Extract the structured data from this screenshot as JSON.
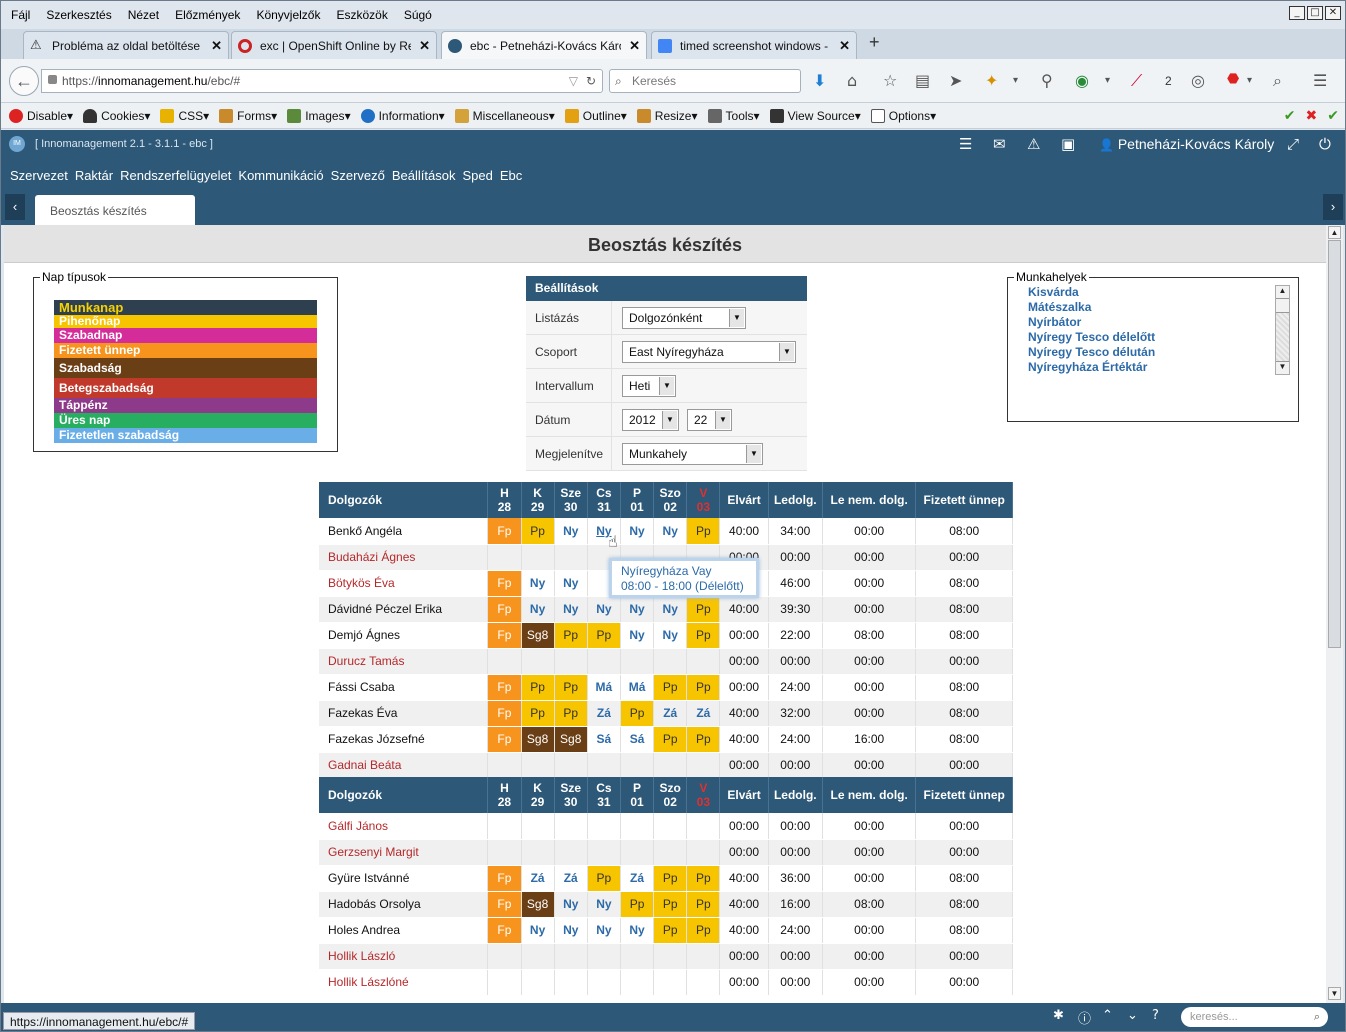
{
  "browser": {
    "menu": [
      "Fájl",
      "Szerkesztés",
      "Nézet",
      "Előzmények",
      "Könyvjelzők",
      "Eszközök",
      "Súgó"
    ],
    "tabs": [
      {
        "title": "Probléma az oldal betöltése k...",
        "icon": "warning-icon"
      },
      {
        "title": "exc | OpenShift Online by Re...",
        "icon": "openshift-icon"
      },
      {
        "title": "ebc - Petneházi-Kovács Károl...",
        "icon": "app-icon"
      },
      {
        "title": "timed screenshot windows - G...",
        "icon": "google-icon"
      }
    ],
    "url_prefix": "https://",
    "url_host": "innomanagement.hu",
    "url_path": "/ebc/#",
    "search_placeholder": "Keresés",
    "badge_count": "2",
    "devbar": [
      "Disable",
      "Cookies",
      "CSS",
      "Forms",
      "Images",
      "Information",
      "Miscellaneous",
      "Outline",
      "Resize",
      "Tools",
      "View Source",
      "Options"
    ]
  },
  "app": {
    "title": "[ Innomanagement 2.1 - 3.1.1 - ebc ]",
    "logo": "IM",
    "user": "Petneházi-Kovács Károly",
    "nav": [
      "Szervezet",
      "Raktár",
      "Rendszerfelügyelet",
      "Kommunikáció",
      "Szervező",
      "Beállítások",
      "Sped",
      "Ebc"
    ],
    "open_tab": "Beosztás készítés",
    "page_title": "Beosztás készítés"
  },
  "daytypes": {
    "legend": "Nap típusok",
    "items": [
      {
        "label": "Munkanap",
        "color": "#2e3f4f",
        "text": "#f7d200"
      },
      {
        "label": "Pihenőnap",
        "color": "#f7c400",
        "text": "#fff"
      },
      {
        "label": "Szabadnap",
        "color": "#d42d9a",
        "text": "#fff"
      },
      {
        "label": "Fizetett ünnep",
        "color": "#f7941d",
        "text": "#fff"
      },
      {
        "label": "Szabadság",
        "color": "#6b3f16",
        "text": "#fff"
      },
      {
        "label": "Betegszabadság",
        "color": "#c0392b",
        "text": "#fff"
      },
      {
        "label": "Táppénz",
        "color": "#8e3a8a",
        "text": "#fff"
      },
      {
        "label": "Üres nap",
        "color": "#27ae60",
        "text": "#fff"
      },
      {
        "label": "Fizetetlen szabadság",
        "color": "#6aaee8",
        "text": "#fff"
      }
    ]
  },
  "settings": {
    "header": "Beállítások",
    "rows": [
      {
        "label": "Listázás",
        "value": "Dolgozónként"
      },
      {
        "label": "Csoport",
        "value": "East Nyíregyháza"
      },
      {
        "label": "Intervallum",
        "value": "Heti"
      },
      {
        "label": "Dátum",
        "value": "2012",
        "value2": "22"
      },
      {
        "label": "Megjelenítve",
        "value": "Munkahely"
      }
    ]
  },
  "workplaces": {
    "legend": "Munkahelyek",
    "items": [
      "Kisvárda",
      "Mátészalka",
      "Nyírbátor",
      "Nyíregy Tesco délelőtt",
      "Nyíregy Tesco délután",
      "Nyíregyháza Értéktár"
    ]
  },
  "table": {
    "headers": {
      "name": "Dolgozók",
      "days": [
        [
          "H",
          "28"
        ],
        [
          "K",
          "29"
        ],
        [
          "Sze",
          "30"
        ],
        [
          "Cs",
          "31"
        ],
        [
          "P",
          "01"
        ],
        [
          "Szo",
          "02"
        ],
        [
          "V",
          "03"
        ]
      ],
      "cols": [
        "Elvárt",
        "Ledolg.",
        "Le nem. dolg.",
        "Fizetett ünnep"
      ]
    },
    "group1": [
      {
        "name": "Benkő Angéla",
        "red": false,
        "days": [
          "Fp",
          "Pp",
          "Ny",
          "Ny",
          "Ny",
          "Ny",
          "Pp"
        ],
        "vals": [
          "40:00",
          "34:00",
          "00:00",
          "08:00"
        ]
      },
      {
        "name": "Budaházi Ágnes",
        "red": true,
        "days": [
          "",
          "",
          "",
          "",
          "",
          "",
          ""
        ],
        "vals": [
          "00:00",
          "00:00",
          "00:00",
          "00:00"
        ]
      },
      {
        "name": "Bötykös Éva",
        "red": true,
        "days": [
          "Fp",
          "Ny",
          "Ny",
          "",
          "",
          "",
          ""
        ],
        "vals": [
          "",
          "46:00",
          "00:00",
          "08:00"
        ]
      },
      {
        "name": "Dávidné Péczel Erika",
        "red": false,
        "days": [
          "Fp",
          "Ny",
          "Ny",
          "Ny",
          "Ny",
          "Ny",
          "Pp"
        ],
        "vals": [
          "40:00",
          "39:30",
          "00:00",
          "08:00"
        ]
      },
      {
        "name": "Demjó Ágnes",
        "red": false,
        "days": [
          "Fp",
          "Sg8",
          "Pp",
          "Pp",
          "Ny",
          "Ny",
          "Pp"
        ],
        "vals": [
          "00:00",
          "22:00",
          "08:00",
          "08:00"
        ]
      },
      {
        "name": "Durucz Tamás",
        "red": true,
        "days": [
          "",
          "",
          "",
          "",
          "",
          "",
          ""
        ],
        "vals": [
          "00:00",
          "00:00",
          "00:00",
          "00:00"
        ]
      },
      {
        "name": "Fássi Csaba",
        "red": false,
        "days": [
          "Fp",
          "Pp",
          "Pp",
          "Má",
          "Má",
          "Pp",
          "Pp"
        ],
        "vals": [
          "00:00",
          "24:00",
          "00:00",
          "08:00"
        ]
      },
      {
        "name": "Fazekas Éva",
        "red": false,
        "days": [
          "Fp",
          "Pp",
          "Pp",
          "Zá",
          "Pp",
          "Zá",
          "Zá"
        ],
        "vals": [
          "40:00",
          "32:00",
          "00:00",
          "08:00"
        ]
      },
      {
        "name": "Fazekas Józsefné",
        "red": false,
        "days": [
          "Fp",
          "Sg8",
          "Sg8",
          "Sá",
          "Sá",
          "Pp",
          "Pp"
        ],
        "vals": [
          "40:00",
          "24:00",
          "16:00",
          "08:00"
        ]
      },
      {
        "name": "Gadnai Beáta",
        "red": true,
        "days": [
          "",
          "",
          "",
          "",
          "",
          "",
          ""
        ],
        "vals": [
          "00:00",
          "00:00",
          "00:00",
          "00:00"
        ]
      }
    ],
    "group2": [
      {
        "name": "Gálfi János",
        "red": true,
        "days": [
          "",
          "",
          "",
          "",
          "",
          "",
          ""
        ],
        "vals": [
          "00:00",
          "00:00",
          "00:00",
          "00:00"
        ]
      },
      {
        "name": "Gerzsenyi Margit",
        "red": true,
        "days": [
          "",
          "",
          "",
          "",
          "",
          "",
          ""
        ],
        "vals": [
          "00:00",
          "00:00",
          "00:00",
          "00:00"
        ]
      },
      {
        "name": "Gyüre Istvánné",
        "red": false,
        "days": [
          "Fp",
          "Zá",
          "Zá",
          "Pp",
          "Zá",
          "Pp",
          "Pp"
        ],
        "vals": [
          "40:00",
          "36:00",
          "00:00",
          "08:00"
        ]
      },
      {
        "name": "Hadobás Orsolya",
        "red": false,
        "days": [
          "Fp",
          "Sg8",
          "Ny",
          "Ny",
          "Pp",
          "Pp",
          "Pp"
        ],
        "vals": [
          "40:00",
          "16:00",
          "08:00",
          "08:00"
        ]
      },
      {
        "name": "Holes Andrea",
        "red": false,
        "days": [
          "Fp",
          "Ny",
          "Ny",
          "Ny",
          "Ny",
          "Pp",
          "Pp"
        ],
        "vals": [
          "40:00",
          "24:00",
          "00:00",
          "08:00"
        ]
      },
      {
        "name": "Hollik László",
        "red": true,
        "days": [
          "",
          "",
          "",
          "",
          "",
          "",
          ""
        ],
        "vals": [
          "00:00",
          "00:00",
          "00:00",
          "00:00"
        ]
      },
      {
        "name": "Hollik Lászlóné",
        "red": true,
        "days": [
          "",
          "",
          "",
          "",
          "",
          "",
          ""
        ],
        "vals": [
          "00:00",
          "00:00",
          "00:00",
          "00:00"
        ]
      }
    ]
  },
  "tooltip": {
    "line1": "Nyíregyháza Vay",
    "line2": "08:00 - 18:00 (Délelőtt)"
  },
  "status": {
    "url": "https://innomanagement.hu/ebc/#",
    "search_placeholder": "keresés..."
  }
}
